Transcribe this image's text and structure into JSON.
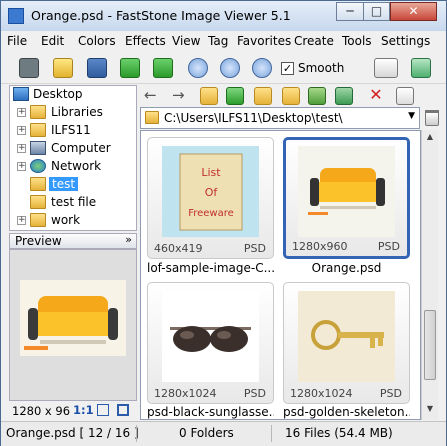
{
  "window": {
    "title": "Orange.psd - FastStone Image Viewer 5.1",
    "min_label": "─",
    "max_label": "□",
    "close_label": "✕"
  },
  "menu": [
    "File",
    "Edit",
    "Colors",
    "Effects",
    "View",
    "Tag",
    "Favorites",
    "Create",
    "Tools",
    "Settings"
  ],
  "toolbar": {
    "icons": [
      "camera-icon",
      "open-icon",
      "save-icon",
      "prev-icon",
      "next-icon",
      "zoom-in-icon",
      "zoom-out-icon",
      "actual-size-icon",
      "fit-icon"
    ],
    "smooth_label": "Smooth",
    "smooth_checked": true,
    "smooth_mark": "✓"
  },
  "tree": {
    "root": "Desktop",
    "items": [
      "Libraries",
      "ILFS11",
      "Computer",
      "Network",
      "test",
      "test file",
      "work"
    ],
    "selected": "test"
  },
  "preview": {
    "header": "Preview",
    "collapse_glyph": "»",
    "dimensions": "1280 x 96",
    "ratio_label": "1:1"
  },
  "nav": {
    "back": "←",
    "forward": "→",
    "path": "C:\\Users\\ILFS11\\Desktop\\test\\",
    "delete": "✕"
  },
  "thumbnails": [
    {
      "caption": "lof-sample-image-C...",
      "dims": "460x419",
      "format": "PSD",
      "selected": false
    },
    {
      "caption": "Orange.psd",
      "dims": "1280x960",
      "format": "PSD",
      "selected": true
    },
    {
      "caption": "psd-black-sunglasse...",
      "dims": "1280x1024",
      "format": "PSD",
      "selected": false
    },
    {
      "caption": "psd-golden-skeleton...",
      "dims": "1280x1024",
      "format": "PSD",
      "selected": false
    }
  ],
  "scrollbar": {
    "up": "▲",
    "down": "▼"
  },
  "status": {
    "file": "Orange.psd [ 12 / 16 ]",
    "folders": "0 Folders",
    "files": "16 Files (54.4 MB)"
  },
  "colors": {
    "selection": "#3465b4",
    "tree_selected": "#3399ff",
    "title_gradient_top": "#e6eef8"
  }
}
